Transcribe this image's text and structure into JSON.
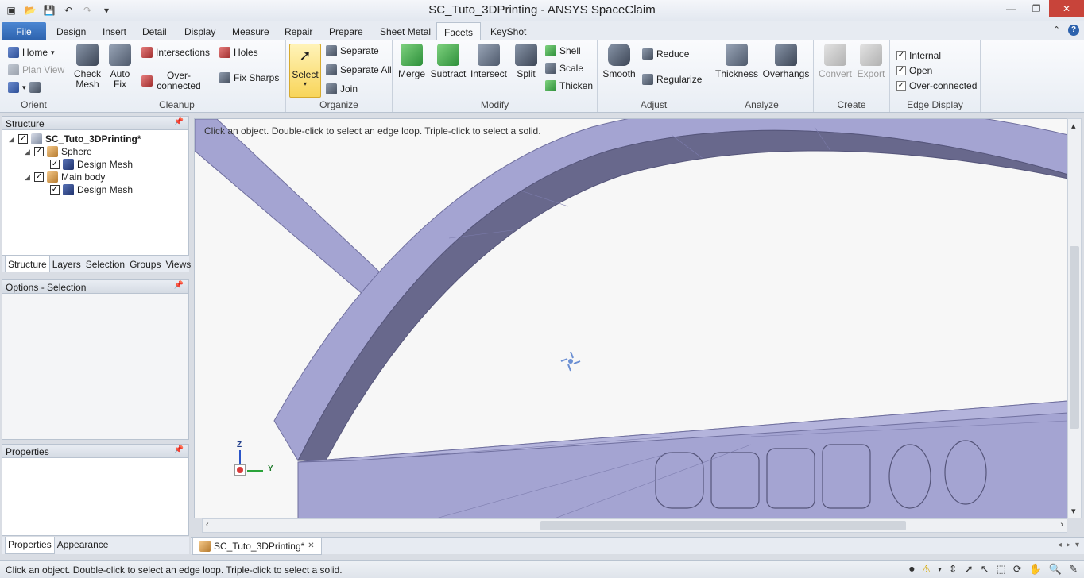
{
  "window": {
    "title": "SC_Tuto_3DPrinting - ANSYS SpaceClaim"
  },
  "tabs": [
    "File",
    "Design",
    "Insert",
    "Detail",
    "Display",
    "Measure",
    "Repair",
    "Prepare",
    "Sheet Metal",
    "Facets",
    "KeyShot"
  ],
  "active_tab": "Facets",
  "ribbon": {
    "orient": {
      "label": "Orient",
      "home": "Home",
      "plan_view": "Plan View"
    },
    "cleanup": {
      "label": "Cleanup",
      "check_mesh": "Check Mesh",
      "auto_fix": "Auto Fix",
      "intersections": "Intersections",
      "overconnected": "Over-connected",
      "holes": "Holes",
      "fix_sharps": "Fix Sharps"
    },
    "organize": {
      "label": "Organize",
      "select": "Select",
      "separate": "Separate",
      "separate_all": "Separate All",
      "join": "Join"
    },
    "modify": {
      "label": "Modify",
      "merge": "Merge",
      "subtract": "Subtract",
      "intersect": "Intersect",
      "split": "Split",
      "shell": "Shell",
      "scale": "Scale",
      "thicken": "Thicken"
    },
    "adjust": {
      "label": "Adjust",
      "smooth": "Smooth",
      "reduce": "Reduce",
      "regularize": "Regularize"
    },
    "analyze": {
      "label": "Analyze",
      "thickness": "Thickness",
      "overhangs": "Overhangs"
    },
    "create": {
      "label": "Create",
      "convert": "Convert",
      "export": "Export"
    },
    "edge_display": {
      "label": "Edge Display",
      "internal": "Internal",
      "open": "Open",
      "overconnected": "Over-connected"
    }
  },
  "structure_panel": {
    "title": "Structure",
    "tree": {
      "root": "SC_Tuto_3DPrinting*",
      "sphere": "Sphere",
      "sphere_mesh": "Design Mesh",
      "main_body": "Main body",
      "main_mesh": "Design Mesh"
    },
    "tabs": [
      "Structure",
      "Layers",
      "Selection",
      "Groups",
      "Views"
    ]
  },
  "options_panel": {
    "title": "Options - Selection"
  },
  "properties_panel": {
    "title": "Properties",
    "tabs": [
      "Properties",
      "Appearance"
    ]
  },
  "viewport": {
    "hint": "Click an object. Double-click to select an edge loop. Triple-click to select a solid.",
    "triad": {
      "z": "Z",
      "y": "Y"
    }
  },
  "doc_tab": {
    "name": "SC_Tuto_3DPrinting*"
  },
  "status": {
    "text": "Click an object. Double-click to select an edge loop. Triple-click to select a solid."
  },
  "colors": {
    "mesh_fill": "#a4a4d2",
    "mesh_edge": "#6f6f9e",
    "mesh_dark": "#68688c",
    "accent": "#2d62ad"
  }
}
